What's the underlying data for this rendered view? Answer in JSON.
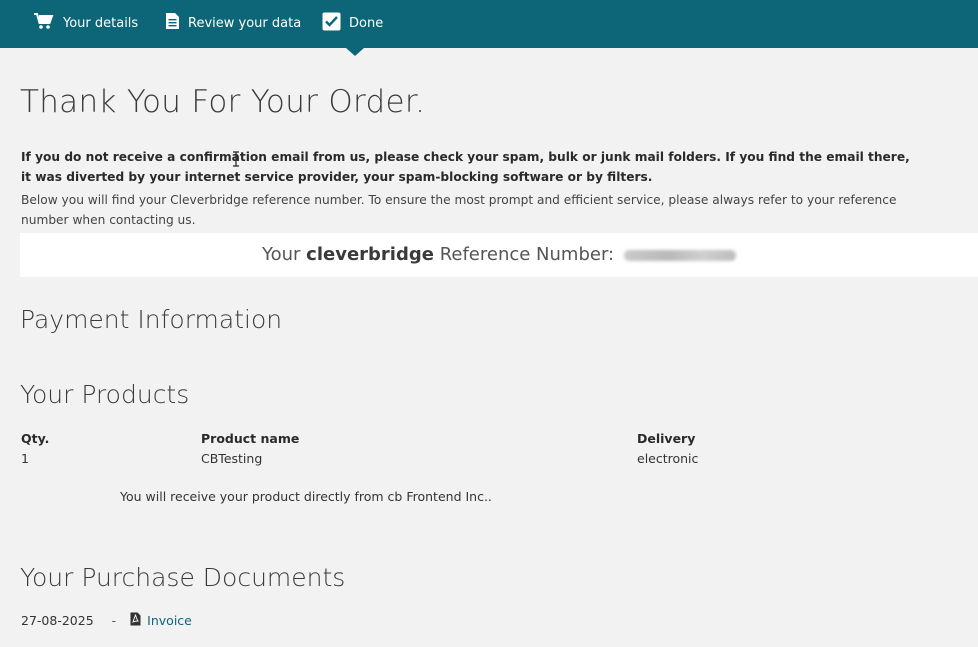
{
  "nav": {
    "steps": [
      {
        "label": "Your details",
        "icon": "cart-icon"
      },
      {
        "label": "Review your data",
        "icon": "document-icon"
      },
      {
        "label": "Done",
        "icon": "checkbox-checked-icon"
      }
    ],
    "active_step": "Done",
    "color": "#0c6677"
  },
  "main": {
    "title": "Thank You For Your Order.",
    "notice_bold": "If you do not receive a confirmation email from us, please check your spam, bulk or junk mail folders. If you find the email there, it was diverted by your internet service provider, your spam-blocking software or by filters.",
    "notice": "Below you will find your Cleverbridge reference number. To ensure the most prompt and efficient service, please always refer to your reference number when contacting us.",
    "reference": {
      "prefix": "Your",
      "brand": "cleverbridge",
      "suffix": "Reference Number:",
      "value_hidden": true
    },
    "payment_title": "Payment Information",
    "products": {
      "title": "Your Products",
      "headers": {
        "qty": "Qty.",
        "name": "Product name",
        "delivery": "Delivery"
      },
      "rows": [
        {
          "qty": "1",
          "name": "CBTesting",
          "delivery": "electronic"
        }
      ],
      "delivery_note": "You will receive your product directly from cb Frontend Inc.."
    },
    "documents": {
      "title": "Your Purchase Documents",
      "items": [
        {
          "date": "27-08-2025",
          "separator": "-",
          "link_label": "Invoice",
          "icon": "pdf-icon"
        }
      ]
    }
  }
}
